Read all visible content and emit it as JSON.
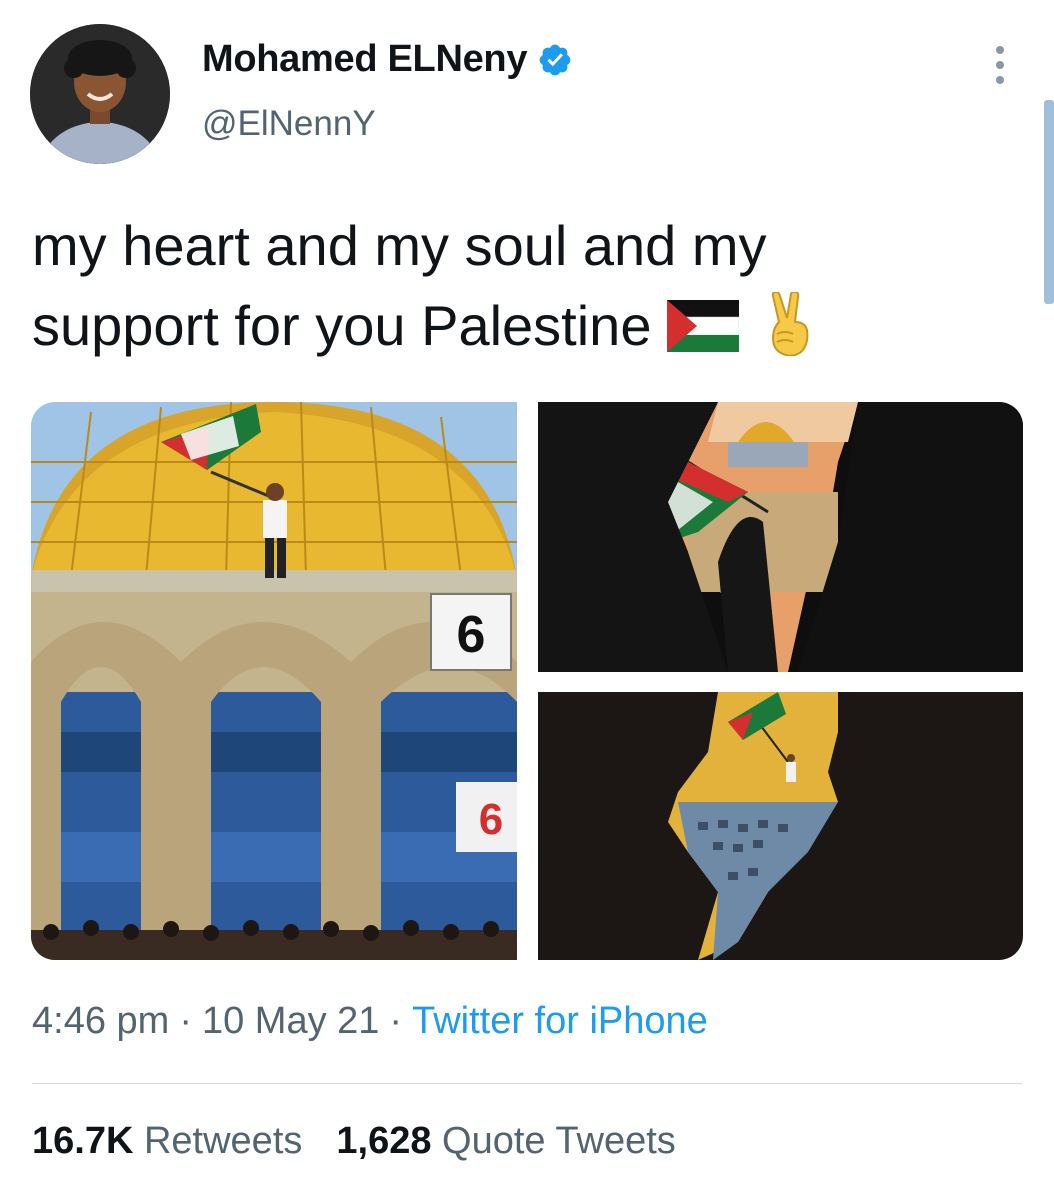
{
  "author": {
    "display_name": "Mohamed ELNeny",
    "handle": "@ElNennY",
    "verified": true,
    "avatar_icon": "profile-photo"
  },
  "tweet": {
    "text_line1": "my heart and my soul and my",
    "text_line2": "support for you  Palestine",
    "emojis": [
      "palestine-flag-emoji",
      "victory-hand-emoji"
    ]
  },
  "media": {
    "count": 3,
    "items": [
      {
        "icon": "dome-of-the-rock-photo"
      },
      {
        "icon": "silhouette-with-flag-photo"
      },
      {
        "icon": "dome-crowd-collage-photo"
      }
    ]
  },
  "meta": {
    "time": "4:46 pm",
    "date": "10 May 21",
    "separator": "·",
    "source": "Twitter for iPhone"
  },
  "stats": {
    "retweets_count": "16.7K",
    "retweets_label": "Retweets",
    "quotes_count": "1,628",
    "quotes_label": "Quote Tweets"
  },
  "colors": {
    "accent": "#1d9bf0",
    "text": "#0f1419",
    "secondary": "#536471",
    "divider": "#cfd9de",
    "flag_red": "#d32f2f",
    "flag_green": "#1b7a3a"
  }
}
